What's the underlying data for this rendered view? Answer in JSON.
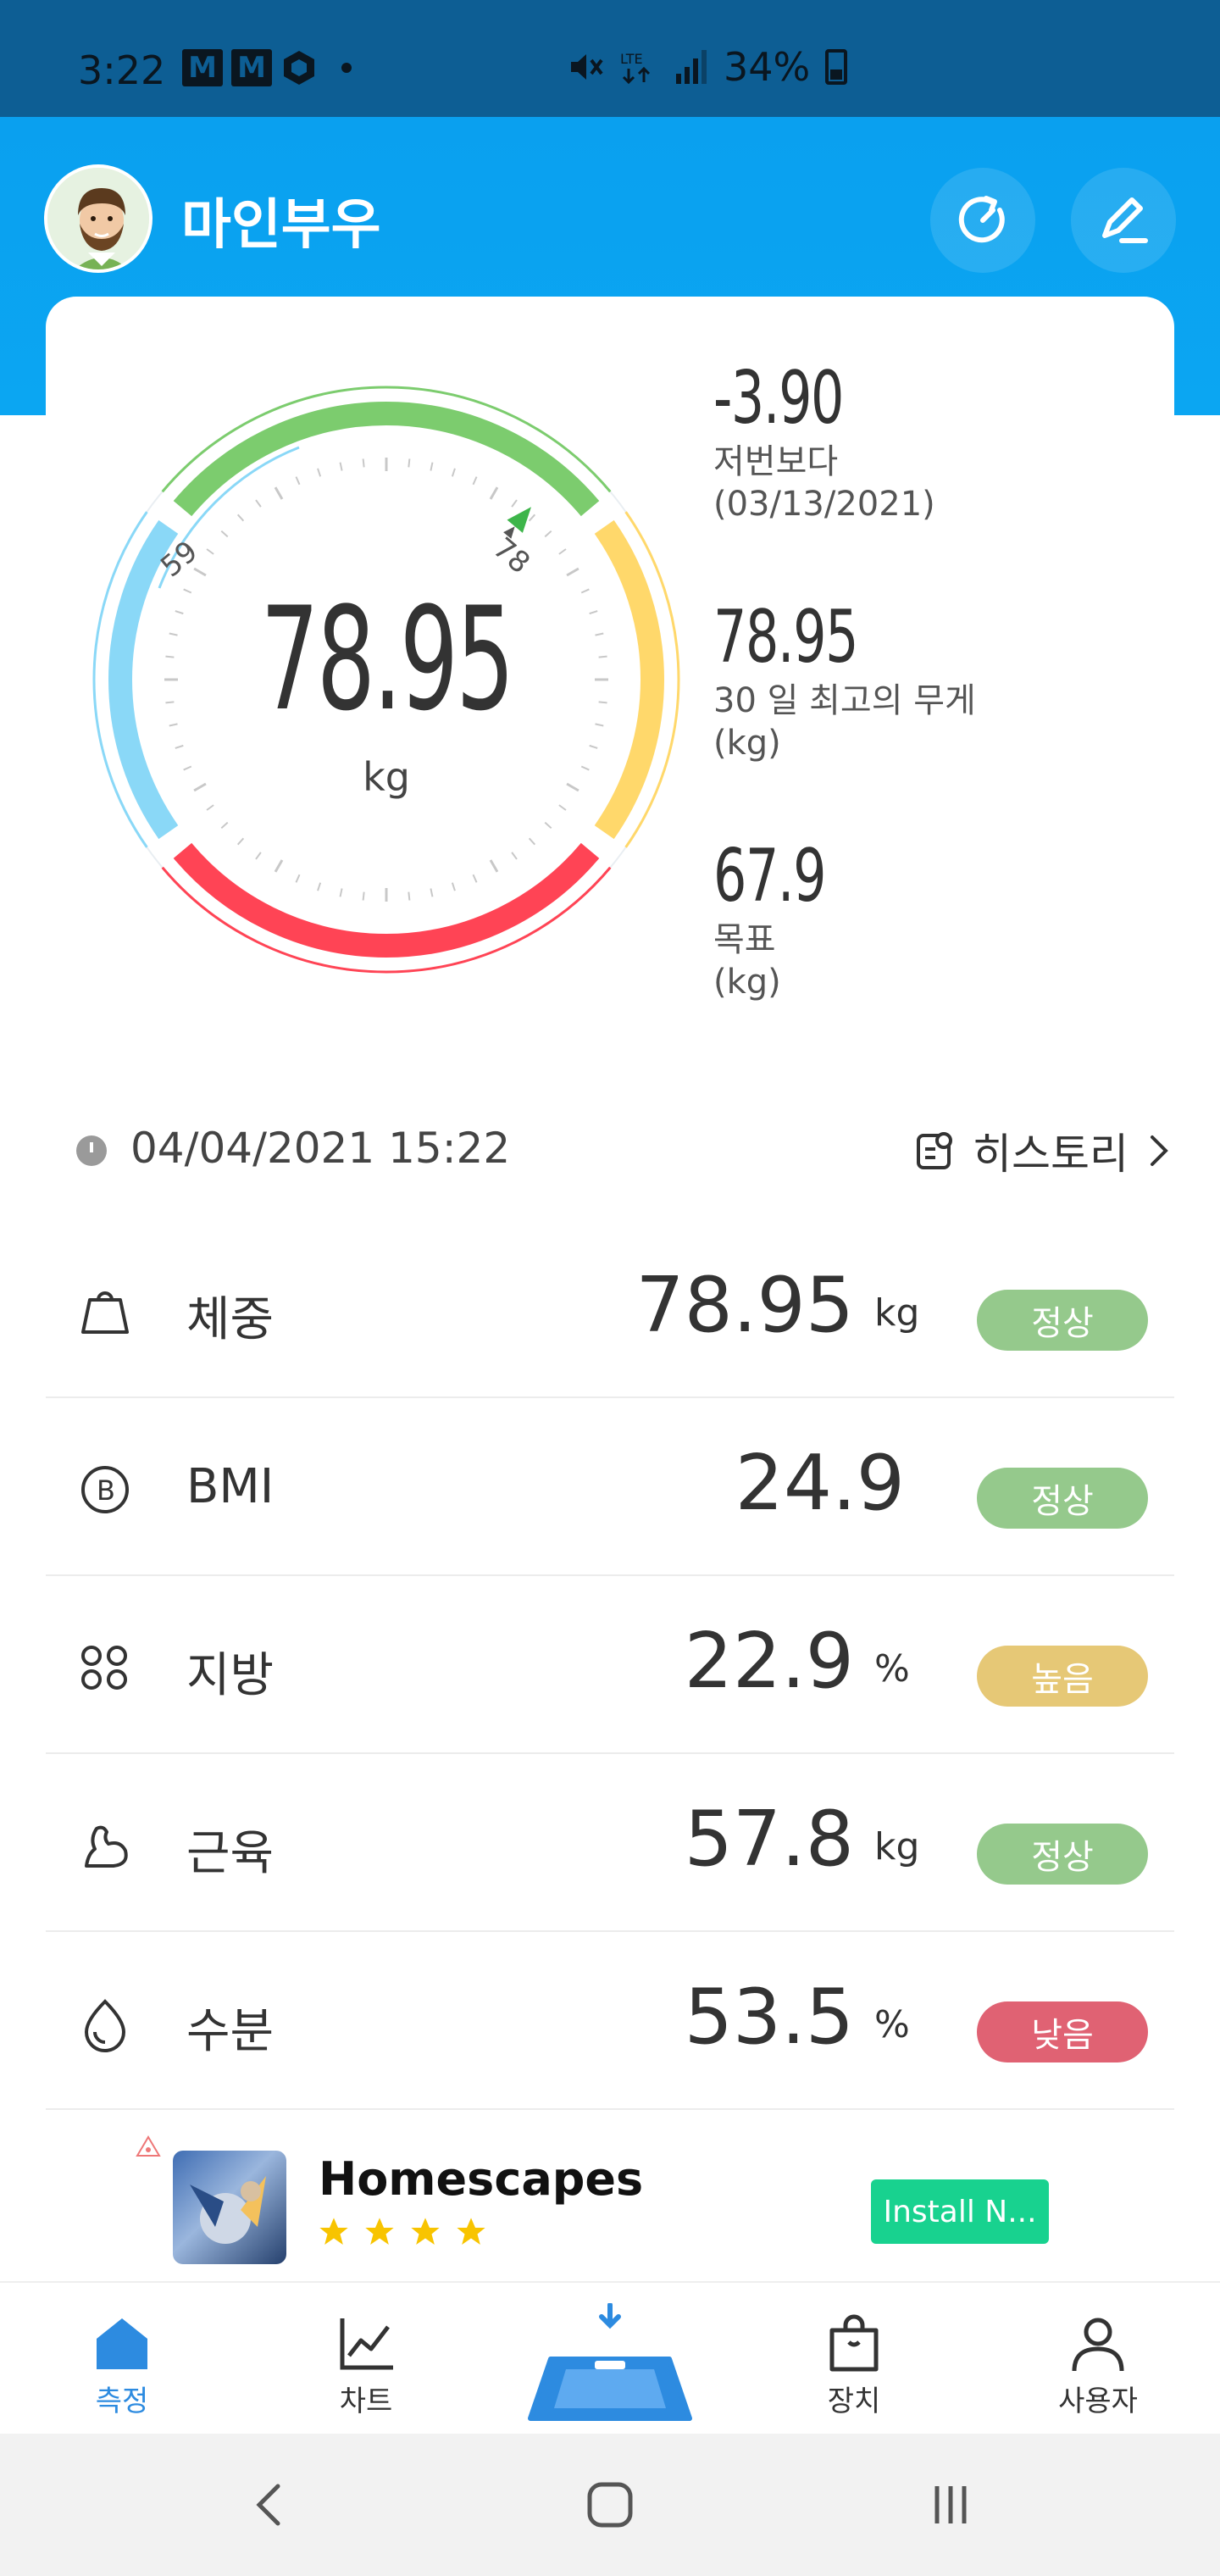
{
  "status_bar": {
    "time": "3:22",
    "left_icons": [
      "M",
      "M"
    ],
    "battery": "34%"
  },
  "header": {
    "username": "마인부우",
    "refresh_icon": "refresh-icon",
    "edit_icon": "edit-icon"
  },
  "gauge": {
    "value": "78.95",
    "unit": "kg",
    "left_tick": "59",
    "right_tick": "78",
    "colors": {
      "green": "#7ccc6e",
      "yellow": "#ffd86b",
      "red": "#ff4455",
      "blue": "#8ad8f7"
    }
  },
  "stats": [
    {
      "value": "-3.90",
      "label1": "저번보다",
      "label2": "(03/13/2021)"
    },
    {
      "value": "78.95",
      "label1": "30 일 최고의 무게",
      "label2": "(kg)"
    },
    {
      "value": "67.9",
      "label1": "목표",
      "label2": "(kg)"
    }
  ],
  "date_row": {
    "datetime": "04/04/2021 15:22",
    "history": "히스토리"
  },
  "metrics": [
    {
      "name": "체중",
      "value": "78.95",
      "unit": "kg",
      "status": "정상",
      "status_color": "#95c98c",
      "icon": "weight-icon"
    },
    {
      "name": "BMI",
      "value": "24.9",
      "unit": "",
      "status": "정상",
      "status_color": "#95c98c",
      "icon": "bmi-icon"
    },
    {
      "name": "지방",
      "value": "22.9",
      "unit": "%",
      "status": "높음",
      "status_color": "#e6c876",
      "icon": "fat-icon"
    },
    {
      "name": "근육",
      "value": "57.8",
      "unit": "kg",
      "status": "정상",
      "status_color": "#95c98c",
      "icon": "muscle-icon"
    },
    {
      "name": "수분",
      "value": "53.5",
      "unit": "%",
      "status": "낮음",
      "status_color": "#e06273",
      "icon": "water-icon"
    }
  ],
  "ad": {
    "title": "Homescapes",
    "stars": 4,
    "button": "Install N..."
  },
  "bottom_nav": [
    {
      "label": "측정",
      "icon": "home-icon",
      "active": true
    },
    {
      "label": "차트",
      "icon": "chart-icon",
      "active": false
    },
    {
      "label": "",
      "icon": "scale-icon",
      "active": false
    },
    {
      "label": "장치",
      "icon": "device-bag-icon",
      "active": false
    },
    {
      "label": "사용자",
      "icon": "user-icon",
      "active": false
    }
  ]
}
